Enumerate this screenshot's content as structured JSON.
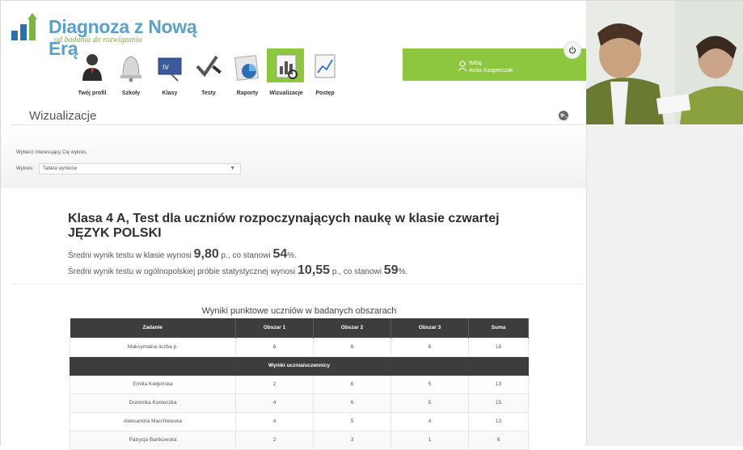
{
  "app": {
    "logo_title": "Diagnoza z Nową Erą",
    "logo_subtitle": "od badania do rozwiązania"
  },
  "user": {
    "greeting": "Witaj",
    "name": "Anita Kasperczak"
  },
  "nav": {
    "items": [
      {
        "label": "Twój profil",
        "icon": "user-profile-icon"
      },
      {
        "label": "Szkoły",
        "icon": "school-bell-icon"
      },
      {
        "label": "Klasy",
        "icon": "class-board-icon"
      },
      {
        "label": "Testy",
        "icon": "test-check-icon"
      },
      {
        "label": "Raporty",
        "icon": "report-pie-icon"
      },
      {
        "label": "Wizualizacje",
        "icon": "visualization-chart-icon",
        "active": true
      },
      {
        "label": "Postęp",
        "icon": "progress-line-icon"
      }
    ]
  },
  "page": {
    "title": "Wizualizacje"
  },
  "filter": {
    "hint": "Wybierz interesujący Cię wykres.",
    "label": "Wykres:",
    "selected": "Tabela wyników"
  },
  "report": {
    "heading": "Klasa 4 A, Test dla uczniów rozpoczynających naukę w klasie czwartej JĘZYK POLSKI",
    "class_avg_prefix": "Średni wynik testu w klasie wynosi ",
    "class_avg_value": "9,80",
    "class_avg_mid": " p., co stanowi ",
    "class_avg_pct": "54",
    "class_avg_suffix": "%.",
    "national_avg_prefix": "Średni wynik testu w ogólnopolskiej próbie statystycznej wynosi ",
    "national_avg_value": "10,55",
    "national_avg_mid": " p., co stanowi ",
    "national_avg_pct": "59",
    "national_avg_suffix": "%."
  },
  "table": {
    "title": "Wyniki punktowe uczniów w badanych obszarach",
    "headers": [
      "Zadanie",
      "Obszar 1",
      "Obszar 2",
      "Obszar 3",
      "Suma"
    ],
    "max_row": [
      "Maksymalna liczba p.",
      "6",
      "6",
      "6",
      "18"
    ],
    "group_label": "Wyniki ucznia/uczennicy",
    "rows": [
      [
        "Emilia Kiełpińska",
        "2",
        "6",
        "5",
        "13"
      ],
      [
        "Dominika Konieczka",
        "4",
        "6",
        "5",
        "15"
      ],
      [
        "Aleksandra Marchlewska",
        "4",
        "5",
        "4",
        "13"
      ],
      [
        "Patrycja Bartkowska",
        "2",
        "3",
        "1",
        "6"
      ]
    ]
  },
  "colors": {
    "brand_green": "#8dc63f",
    "brand_blue": "#5aa0c8",
    "table_header": "#3d3d3d"
  }
}
